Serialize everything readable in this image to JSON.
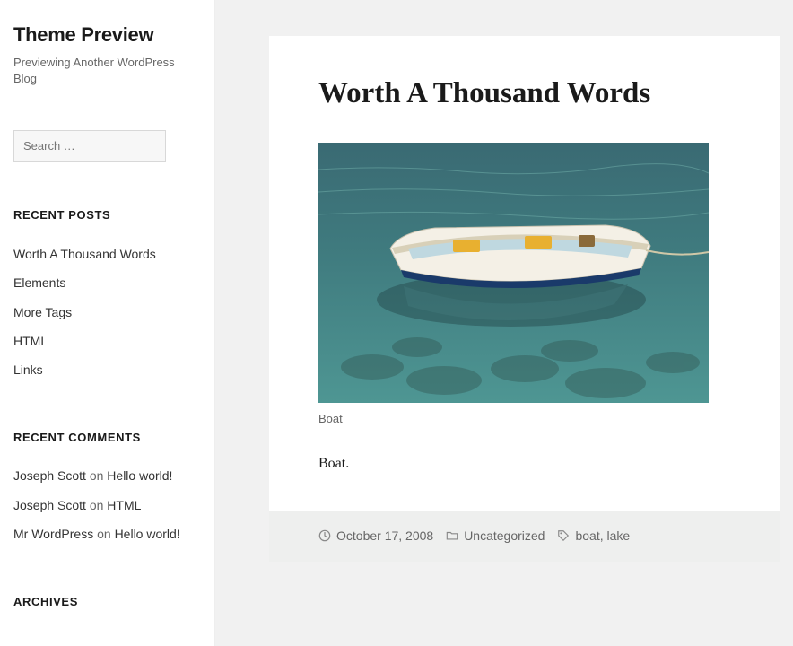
{
  "site": {
    "title": "Theme Preview",
    "tagline": "Previewing Another WordPress Blog"
  },
  "search": {
    "placeholder": "Search …"
  },
  "widgets": {
    "recent_posts": {
      "title": "RECENT POSTS",
      "items": [
        "Worth A Thousand Words",
        "Elements",
        "More Tags",
        "HTML",
        "Links"
      ]
    },
    "recent_comments": {
      "title": "RECENT COMMENTS",
      "items": [
        {
          "author": "Joseph Scott",
          "on": "on",
          "post": "Hello world!"
        },
        {
          "author": "Joseph Scott",
          "on": "on",
          "post": "HTML"
        },
        {
          "author": "Mr WordPress",
          "on": "on",
          "post": "Hello world!"
        }
      ]
    },
    "archives": {
      "title": "ARCHIVES"
    }
  },
  "post": {
    "title": "Worth A Thousand Words",
    "caption": "Boat",
    "content": "Boat.",
    "date": "October 17, 2008",
    "category": "Uncategorized",
    "tags_joined": "boat, lake"
  }
}
